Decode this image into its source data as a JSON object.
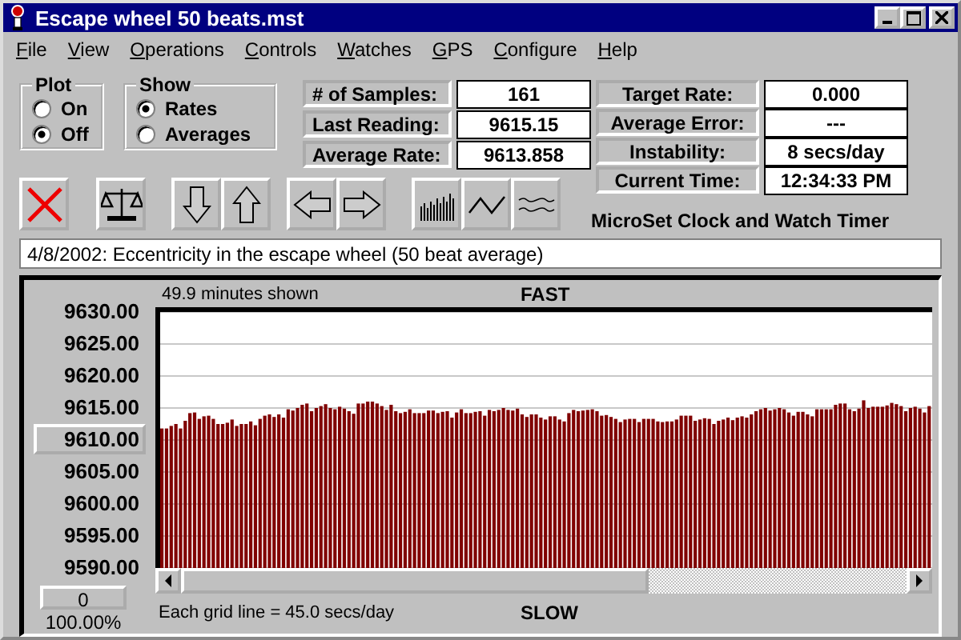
{
  "window": {
    "title": "Escape wheel 50 beats.mst"
  },
  "menu": [
    "File",
    "View",
    "Operations",
    "Controls",
    "Watches",
    "GPS",
    "Configure",
    "Help"
  ],
  "plot_group": {
    "title": "Plot",
    "options": [
      {
        "label": "On",
        "selected": false
      },
      {
        "label": "Off",
        "selected": true
      }
    ]
  },
  "show_group": {
    "title": "Show",
    "options": [
      {
        "label": "Rates",
        "selected": true
      },
      {
        "label": "Averages",
        "selected": false
      }
    ]
  },
  "stats": [
    {
      "label": "# of Samples:",
      "value": "161"
    },
    {
      "label": "Last Reading:",
      "value": "9615.15"
    },
    {
      "label": "Average Rate:",
      "value": "9613.858"
    }
  ],
  "rates": [
    {
      "label": "Target Rate:",
      "value": "0.000"
    },
    {
      "label": "Average Error:",
      "value": "---"
    },
    {
      "label": "Instability:",
      "value": "8 secs/day"
    },
    {
      "label": "Current Time:",
      "value": "12:34:33 PM"
    }
  ],
  "toolbar": [
    {
      "kind": "clear"
    },
    {
      "kind": "scale"
    },
    {
      "kind": "down"
    },
    {
      "kind": "up"
    },
    {
      "kind": "left"
    },
    {
      "kind": "right"
    },
    {
      "kind": "bars"
    },
    {
      "kind": "zigzag"
    },
    {
      "kind": "waves"
    }
  ],
  "product_name": "MicroSet Clock and Watch Timer",
  "note": "4/8/2002: Eccentricity in the escape wheel (50 beat average)",
  "graph": {
    "scale_button": "9610.00",
    "shown": "49.9 minutes shown",
    "top_label": "FAST",
    "bottom_label": "SLOW",
    "grid_note": "Each grid line = 45.0 secs/day",
    "offset_button": "0",
    "zoom": "100.00%",
    "chart_data": {
      "type": "bar",
      "grid": true,
      "ylim": [
        9590,
        9630
      ],
      "yticks": [
        {
          "value": 9630,
          "label": "9630.00"
        },
        {
          "value": 9625,
          "label": "9625.00"
        },
        {
          "value": 9620,
          "label": "9620.00"
        },
        {
          "value": 9615,
          "label": "9615.00"
        },
        {
          "value": 9605,
          "label": "9605.00"
        },
        {
          "value": 9600,
          "label": "9600.00"
        },
        {
          "value": 9595,
          "label": "9595.00"
        },
        {
          "value": 9590,
          "label": "9590.00"
        }
      ],
      "series": [
        {
          "color": "#800000",
          "values": [
            9611.8,
            9611.8,
            9612.2,
            9612.5,
            9611.8,
            9613,
            9614.2,
            9614.3,
            9613.3,
            9613.7,
            9613.8,
            9613.3,
            9612.5,
            9612.5,
            9612.7,
            9613.2,
            9612.2,
            9612.5,
            9612.5,
            9612.9,
            9612.3,
            9613.3,
            9613.8,
            9614,
            9613.6,
            9614,
            9613.5,
            9614.8,
            9614.6,
            9615,
            9615.5,
            9615.7,
            9614.5,
            9615,
            9615.3,
            9615.6,
            9615,
            9614.8,
            9615.2,
            9614.9,
            9614.5,
            9614.1,
            9615.7,
            9615.7,
            9616,
            9616,
            9615.7,
            9615.3,
            9614.7,
            9615.5,
            9614.5,
            9614.2,
            9614.4,
            9614.8,
            9614.2,
            9614.2,
            9614.2,
            9614.6,
            9614.6,
            9614.2,
            9614.4,
            9614.5,
            9613.5,
            9614.3,
            9614.8,
            9614.2,
            9614.2,
            9614.4,
            9614.5,
            9613.8,
            9614.7,
            9614.5,
            9614.7,
            9615,
            9614.7,
            9614.6,
            9614.9,
            9614,
            9613.6,
            9614,
            9614,
            9613.5,
            9613.2,
            9613.7,
            9613.7,
            9613.2,
            9612.9,
            9614.2,
            9614.7,
            9614.5,
            9614.6,
            9614.7,
            9614.8,
            9614.5,
            9613.8,
            9613.9,
            9613.6,
            9613.3,
            9612.8,
            9613.2,
            9613.3,
            9613.3,
            9612.8,
            9613.3,
            9613.3,
            9613.3,
            9612.9,
            9612.8,
            9612.9,
            9612.9,
            9613.2,
            9613.8,
            9613.8,
            9613.8,
            9613,
            9613.2,
            9613.4,
            9613.3,
            9612.5,
            9613,
            9613.2,
            9613.5,
            9613.1,
            9613.5,
            9613.7,
            9613.5,
            9614,
            9614.5,
            9614.8,
            9615,
            9614.6,
            9614.8,
            9615,
            9614.8,
            9614.3,
            9613.8,
            9614.4,
            9614.4,
            9614,
            9613.7,
            9614.8,
            9614.8,
            9614.8,
            9614.8,
            9615.5,
            9615.7,
            9615.7,
            9614.8,
            9614.5,
            9614.9,
            9616.2,
            9615,
            9615.2,
            9615.2,
            9615.2,
            9615.4,
            9615.8,
            9615.6,
            9615.3,
            9614.5,
            9615,
            9615.2,
            9614.9,
            9614.3,
            9615.3
          ]
        }
      ]
    }
  }
}
